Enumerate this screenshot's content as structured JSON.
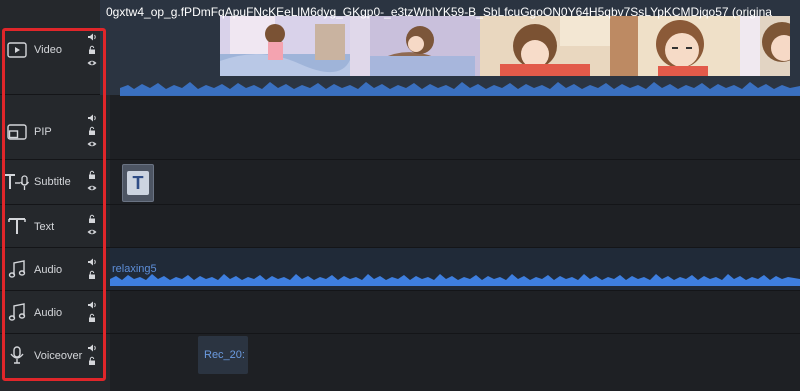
{
  "timeline": {
    "video_clip_title": "0gxtw4_op_g.fPDmFqApuFNcKEeLlM6dyg_GKgp0-_e3tzWhIYK59-B_SbLfcuGgoON0Y64H5qbv7SsLYpKCMDjqo57 (origina",
    "audio_clip_label": "relaxing5",
    "voiceover_clip_label": "Rec_20:",
    "text_clip_glyph": "T"
  },
  "tracks": [
    {
      "id": "video",
      "label": "Video",
      "icon": "video-play-icon",
      "controls": [
        "volume",
        "lock",
        "visibility"
      ]
    },
    {
      "id": "pip",
      "label": "PIP",
      "icon": "pip-icon",
      "controls": [
        "volume",
        "lock",
        "visibility"
      ]
    },
    {
      "id": "subtitle",
      "label": "Subtitle",
      "icon": "subtitle-icon",
      "controls": [
        "lock",
        "visibility"
      ]
    },
    {
      "id": "text",
      "label": "Text",
      "icon": "text-icon",
      "controls": [
        "lock",
        "visibility"
      ]
    },
    {
      "id": "audio1",
      "label": "Audio",
      "icon": "music-note-icon",
      "controls": [
        "volume",
        "lock"
      ]
    },
    {
      "id": "audio2",
      "label": "Audio",
      "icon": "music-note-icon",
      "controls": [
        "volume",
        "lock"
      ]
    },
    {
      "id": "voiceover",
      "label": "Voiceover",
      "icon": "microphone-icon",
      "controls": [
        "volume",
        "lock"
      ]
    }
  ],
  "colors": {
    "highlight": "#e0262a",
    "waveform": "#3e7fe0",
    "audio_text": "#5d8ed8"
  }
}
